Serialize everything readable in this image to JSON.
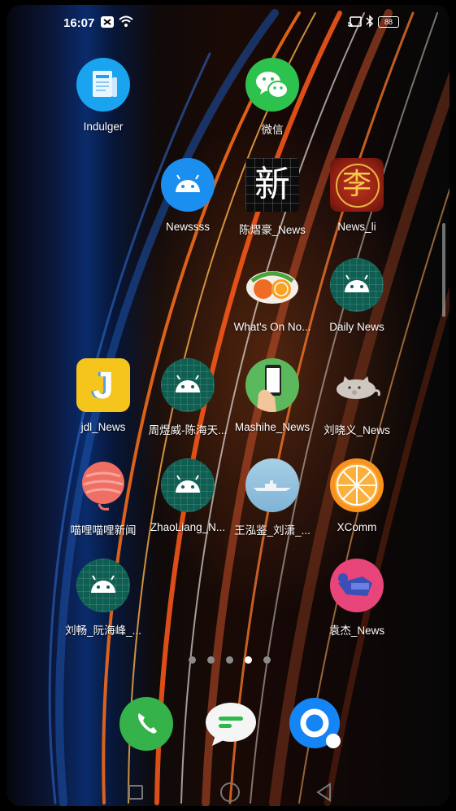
{
  "status_bar": {
    "time": "16:07",
    "battery": "88",
    "icons": [
      "notification-icon",
      "wifi-icon",
      "cast-icon",
      "bluetooth-icon",
      "battery-icon"
    ]
  },
  "apps": [
    {
      "key": "indulger",
      "label": "Indulger",
      "icon": "news-reader-icon"
    },
    {
      "key": "wechat",
      "label": "微信",
      "icon": "wechat-icon"
    },
    {
      "key": "newssss",
      "label": "Newssss",
      "icon": "android-icon"
    },
    {
      "key": "chen",
      "label": "陈熠豪_News",
      "icon": "xin-character-icon",
      "icon_text": "新"
    },
    {
      "key": "news-li",
      "label": "News_li",
      "icon": "li-seal-icon",
      "icon_text": "李"
    },
    {
      "key": "whats-on",
      "label": "What's On No...",
      "icon": "food-bowl-icon"
    },
    {
      "key": "daily-news",
      "label": "Daily News",
      "icon": "android-icon"
    },
    {
      "key": "jdl-news",
      "label": "jdl_News",
      "icon": "letter-j-icon",
      "icon_text": "J"
    },
    {
      "key": "zhou",
      "label": "周煜威-陈海天...",
      "icon": "android-icon"
    },
    {
      "key": "mashihe",
      "label": "Mashihe_News",
      "icon": "phone-in-hand-icon"
    },
    {
      "key": "liu-xiaoyi",
      "label": "刘晓义_News",
      "icon": "cat-icon"
    },
    {
      "key": "miaoli",
      "label": "喵哩喵哩新闻",
      "icon": "yarn-ball-icon"
    },
    {
      "key": "zhaoliang",
      "label": "ZhaoLiang_N...",
      "icon": "android-icon"
    },
    {
      "key": "wang",
      "label": "王泓鉴_刘潇_...",
      "icon": "ship-icon"
    },
    {
      "key": "xcomm",
      "label": "XComm",
      "icon": "orange-slice-icon"
    },
    {
      "key": "liu-chang",
      "label": "刘畅_阮海峰_...",
      "icon": "android-icon"
    },
    {
      "key": "yuanjie",
      "label": "袁杰_News",
      "icon": "person-fly-icon"
    }
  ],
  "page_indicator": {
    "count": 5,
    "active": 4
  },
  "dock": [
    {
      "key": "phone",
      "icon": "phone-icon",
      "color": "#35b34a"
    },
    {
      "key": "messages",
      "icon": "message-bubble-icon",
      "color": "#f5f5f5"
    },
    {
      "key": "search",
      "icon": "search-ring-icon",
      "color": "#1584f4"
    }
  ],
  "nav_bar": [
    "recents-square-icon",
    "home-circle-icon",
    "back-triangle-icon"
  ]
}
